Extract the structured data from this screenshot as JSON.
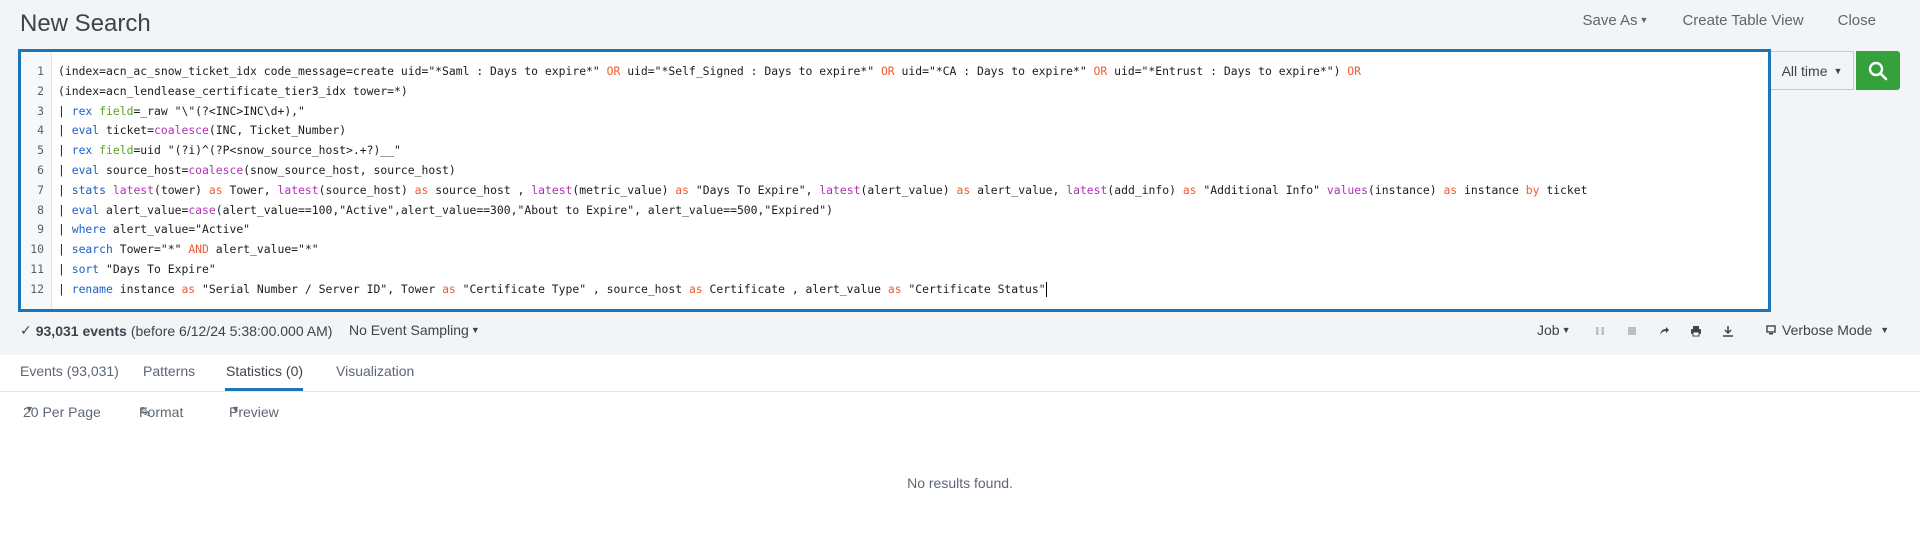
{
  "page": {
    "title": "New Search",
    "actions": [
      "Save As",
      "Create Table View",
      "Close"
    ]
  },
  "editor": {
    "lines": [
      [
        {
          "t": "(index=acn_ac_snow_ticket_idx code_message=create uid=\"*Saml : Days to expire*\" "
        },
        {
          "t": "OR",
          "c": "op"
        },
        {
          "t": " uid=\"*Self_Signed : Days to expire*\" "
        },
        {
          "t": "OR",
          "c": "op"
        },
        {
          "t": " uid=\"*CA : Days to expire*\" "
        },
        {
          "t": "OR",
          "c": "op"
        },
        {
          "t": " uid=\"*Entrust : Days to expire*\") "
        },
        {
          "t": "OR",
          "c": "op"
        }
      ],
      [
        {
          "t": "(index=acn_lendlease_certificate_tier3_idx tower=*)"
        }
      ],
      [
        {
          "t": "| "
        },
        {
          "t": "rex",
          "c": "cmd"
        },
        {
          "t": " "
        },
        {
          "t": "field",
          "c": "arg"
        },
        {
          "t": "=_raw \"\\\"(?<INC>INC\\d+),\""
        }
      ],
      [
        {
          "t": "| "
        },
        {
          "t": "eval",
          "c": "cmd"
        },
        {
          "t": " ticket="
        },
        {
          "t": "coalesce",
          "c": "fn"
        },
        {
          "t": "(INC, Ticket_Number)"
        }
      ],
      [
        {
          "t": "| "
        },
        {
          "t": "rex",
          "c": "cmd"
        },
        {
          "t": " "
        },
        {
          "t": "field",
          "c": "arg"
        },
        {
          "t": "=uid \"(?i)^(?P<snow_source_host>.+?)__\""
        }
      ],
      [
        {
          "t": "| "
        },
        {
          "t": "eval",
          "c": "cmd"
        },
        {
          "t": " source_host="
        },
        {
          "t": "coalesce",
          "c": "fn"
        },
        {
          "t": "(snow_source_host, source_host)"
        }
      ],
      [
        {
          "t": "| "
        },
        {
          "t": "stats",
          "c": "cmd"
        },
        {
          "t": " "
        },
        {
          "t": "latest",
          "c": "fn"
        },
        {
          "t": "(tower) "
        },
        {
          "t": "as",
          "c": "op"
        },
        {
          "t": " Tower, "
        },
        {
          "t": "latest",
          "c": "fn"
        },
        {
          "t": "(source_host) "
        },
        {
          "t": "as",
          "c": "op"
        },
        {
          "t": " source_host , "
        },
        {
          "t": "latest",
          "c": "fn"
        },
        {
          "t": "(metric_value) "
        },
        {
          "t": "as",
          "c": "op"
        },
        {
          "t": " \"Days To Expire\", "
        },
        {
          "t": "latest",
          "c": "fn"
        },
        {
          "t": "(alert_value) "
        },
        {
          "t": "as",
          "c": "op"
        },
        {
          "t": " alert_value, "
        },
        {
          "t": "latest",
          "c": "fn"
        },
        {
          "t": "(add_info) "
        },
        {
          "t": "as",
          "c": "op"
        },
        {
          "t": " \"Additional Info\" "
        },
        {
          "t": "values",
          "c": "fn"
        },
        {
          "t": "(instance) "
        },
        {
          "t": "as",
          "c": "op"
        },
        {
          "t": " instance "
        },
        {
          "t": "by",
          "c": "op"
        },
        {
          "t": " ticket"
        }
      ],
      [
        {
          "t": "| "
        },
        {
          "t": "eval",
          "c": "cmd"
        },
        {
          "t": " alert_value="
        },
        {
          "t": "case",
          "c": "fn"
        },
        {
          "t": "(alert_value==100,\"Active\",alert_value==300,\"About to Expire\", alert_value==500,\"Expired\")"
        }
      ],
      [
        {
          "t": "| "
        },
        {
          "t": "where",
          "c": "cmd"
        },
        {
          "t": " alert_value=\"Active\""
        }
      ],
      [
        {
          "t": "| "
        },
        {
          "t": "search",
          "c": "cmd"
        },
        {
          "t": " Tower=\"*\" "
        },
        {
          "t": "AND",
          "c": "op"
        },
        {
          "t": " alert_value=\"*\""
        }
      ],
      [
        {
          "t": "| "
        },
        {
          "t": "sort",
          "c": "cmd"
        },
        {
          "t": " \"Days To Expire\""
        }
      ],
      [
        {
          "t": "| "
        },
        {
          "t": "rename",
          "c": "cmd"
        },
        {
          "t": " instance "
        },
        {
          "t": "as",
          "c": "op"
        },
        {
          "t": " \"Serial Number / Server ID\", Tower "
        },
        {
          "t": "as",
          "c": "op"
        },
        {
          "t": " \"Certificate Type\" , source_host "
        },
        {
          "t": "as",
          "c": "op"
        },
        {
          "t": " Certificate , alert_value "
        },
        {
          "t": "as",
          "c": "op"
        },
        {
          "t": " \"Certificate Status\""
        }
      ]
    ]
  },
  "time_picker": {
    "label": "All time"
  },
  "status": {
    "check": "✓",
    "event_count": "93,031 events",
    "before": "(before 6/12/24 5:38:00.000 AM)",
    "sampling": "No Event Sampling",
    "job": "Job",
    "mode": "Verbose Mode"
  },
  "tabs": [
    "Events (93,031)",
    "Patterns",
    "Statistics (0)",
    "Visualization"
  ],
  "active_tab": "Statistics (0)",
  "toolbar": {
    "per_page": "20 Per Page",
    "format": "Format",
    "preview": "Preview"
  },
  "results": {
    "empty_message": "No results found."
  },
  "colors": {
    "accent": "#1a76b8",
    "search_button": "#35a13a",
    "keyword_operator": "#ef5c32",
    "keyword_command": "#1f5fc4",
    "keyword_function": "#b230b5",
    "keyword_argument": "#5ba41a"
  },
  "icons": [
    "search-icon",
    "pause-icon",
    "stop-icon",
    "share-icon",
    "print-icon",
    "export-icon",
    "mode-icon",
    "pencil-icon"
  ]
}
